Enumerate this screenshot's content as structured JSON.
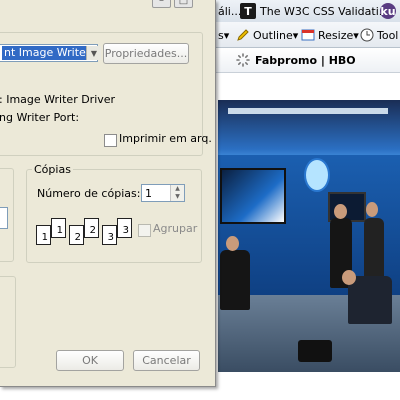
{
  "browser": {
    "tabs": [
      {
        "label": "áli...",
        "icon": "browser-tab-icon"
      },
      {
        "label": "The W3C CSS Validati...",
        "icon": "w3c-icon"
      },
      {
        "label": "",
        "icon": "extension-icon"
      }
    ],
    "toolbar": [
      {
        "label": "s▾",
        "icon": "menu-icon"
      },
      {
        "label": "Outline▾",
        "icon": "pencil-icon"
      },
      {
        "label": "Resize▾",
        "icon": "resize-icon"
      },
      {
        "label": "Tool",
        "icon": "clock-icon"
      }
    ],
    "page_tab": {
      "label": "Fabpromo | HBO",
      "icon": "loading-spinner-icon"
    }
  },
  "dialog": {
    "printer_selected": "nt Image Writer",
    "properties_button": "Propriedades...",
    "status_line1": ": Image Writer Driver",
    "status_line2": "ng Writer Port:",
    "print_to_file_label": "Imprimir em arq.",
    "copies_group_title": "Cópias",
    "copies_label": "Número de cópias:",
    "copies_value": "1",
    "collate_label": "Agrupar",
    "collate_icons": [
      [
        "1",
        "1"
      ],
      [
        "2",
        "2"
      ],
      [
        "3",
        "3"
      ]
    ],
    "ok_button": "OK",
    "cancel_button": "Cancelar",
    "window_buttons": [
      "–",
      "□"
    ]
  },
  "colors": {
    "selection": "#316ac5",
    "dialog_bg": "#ece9d8"
  }
}
